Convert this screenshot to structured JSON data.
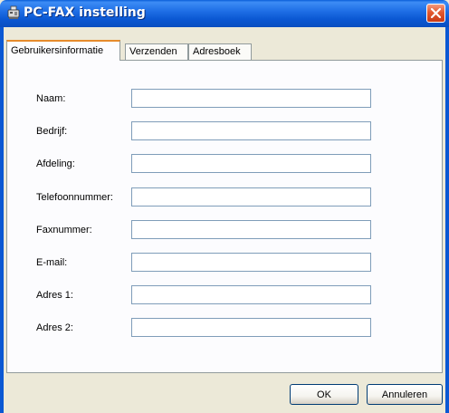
{
  "window": {
    "title": "PC-FAX instelling",
    "title_icon": "fax-icon",
    "close_icon": "close-icon",
    "accent_color": "#0b58d3"
  },
  "tabs": [
    {
      "label": "Gebruikersinformatie",
      "active": true
    },
    {
      "label": "Verzenden",
      "active": false
    },
    {
      "label": "Adresboek",
      "active": false
    }
  ],
  "form": {
    "fields": [
      {
        "label": "Naam:",
        "value": ""
      },
      {
        "label": "Bedrijf:",
        "value": ""
      },
      {
        "label": "Afdeling:",
        "value": ""
      },
      {
        "label": "Telefoonnummer:",
        "value": ""
      },
      {
        "label": "Faxnummer:",
        "value": ""
      },
      {
        "label": "E-mail:",
        "value": ""
      },
      {
        "label": "Adres 1:",
        "value": ""
      },
      {
        "label": "Adres 2:",
        "value": ""
      }
    ]
  },
  "buttons": {
    "ok_label": "OK",
    "cancel_label": "Annuleren"
  }
}
